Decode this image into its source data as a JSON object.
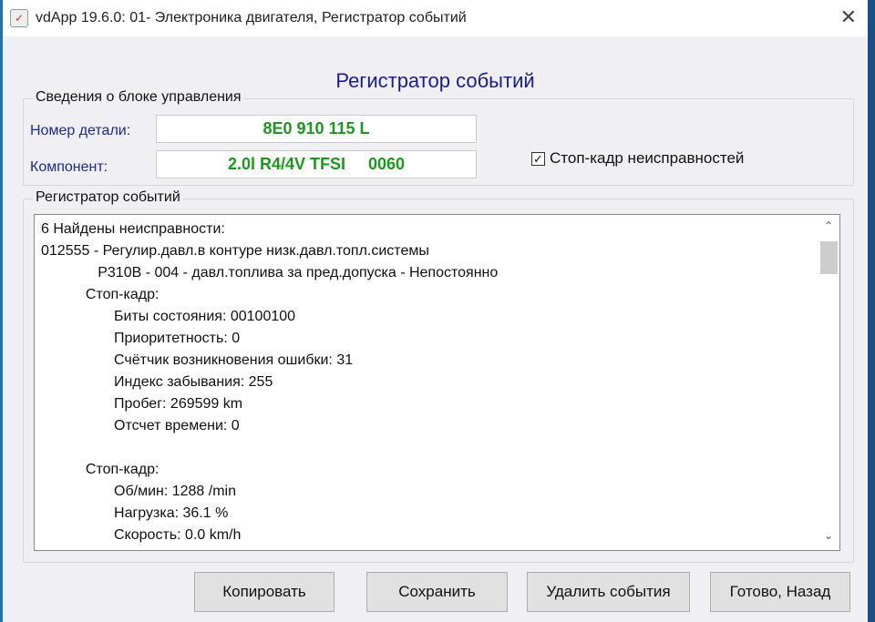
{
  "window": {
    "title": "vdApp 19.6.0: 01- Электроника двигателя,  Регистратор событий"
  },
  "heading": "Регистратор событий",
  "ecu_info": {
    "legend": "Сведения о блоке управления",
    "part_label": "Номер детали:",
    "part_value": "8E0 910 115 L",
    "component_label": "Компонент:",
    "component_value": "2.0l R4/4V TFSI     0060",
    "freeze_frame_checkbox": {
      "label": "Стоп-кадр неисправностей",
      "checked": true
    }
  },
  "event_log": {
    "legend": "Регистратор событий",
    "lines": [
      "6 Найдены неисправности:",
      "012555 - Регулир.давл.в контуре низк.давл.топл.системы",
      "              P310B - 004 - давл.топлива за пред.допуска - Непостоянно",
      "           Стоп-кадр:",
      "                  Биты состояния: 00100100",
      "                  Приоритетность: 0",
      "                  Счётчик возникновения ошибки: 31",
      "                  Индекс забывания: 255",
      "                  Пробег: 269599 km",
      "                  Отсчет времени: 0",
      "",
      "           Стоп-кадр:",
      "                  Об/мин: 1288 /min",
      "                  Нагрузка: 36.1 %",
      "                  Скорость: 0.0 km/h"
    ]
  },
  "buttons": {
    "copy": "Копировать",
    "save": "Сохранить",
    "delete": "Удалить события",
    "done": "Готово, Назад"
  }
}
